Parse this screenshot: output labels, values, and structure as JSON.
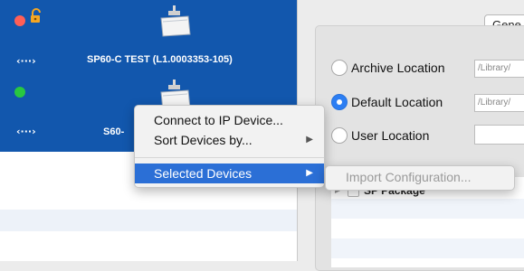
{
  "colors": {
    "selection_blue": "#1257ad",
    "menu_highlight": "#2b6fd6",
    "status_red": "#ff5f57",
    "status_green": "#28c840",
    "stripe": "#eef2f8"
  },
  "device_list": {
    "devices": [
      {
        "label": "SP60-C TEST (L1.0003353-105)",
        "status": "red",
        "status_icon": "red-status-dot",
        "lock_icon": "open-lock-icon",
        "fixture_icon": "light-fixture-icon",
        "link_icon": "network-link-icon",
        "link_glyph": "‹···›"
      },
      {
        "label": "S60-",
        "status": "green",
        "status_icon": "green-status-dot",
        "fixture_icon": "light-fixture-icon",
        "link_icon": "network-link-icon",
        "link_glyph": "‹···›"
      }
    ]
  },
  "context_menu": {
    "items": [
      {
        "label": "Connect to IP Device...",
        "has_submenu": false
      },
      {
        "label": "Sort Devices by...",
        "has_submenu": true,
        "arrow": "▶"
      },
      {
        "label": "Selected Devices",
        "has_submenu": true,
        "highlighted": true,
        "arrow": "▶"
      }
    ]
  },
  "submenu": {
    "items": [
      {
        "label": "Import Configuration...",
        "enabled": false
      }
    ]
  },
  "settings": {
    "tab_label": "Gene",
    "locations": [
      {
        "label": "Archive Location",
        "selected": false,
        "path": "/Library/"
      },
      {
        "label": "Default Location",
        "selected": true,
        "path": "/Library/"
      },
      {
        "label": "User Location",
        "selected": false,
        "path": ""
      }
    ],
    "package_row": {
      "label": "SP Package",
      "expand_icon": "disclosure-triangle-icon"
    }
  }
}
